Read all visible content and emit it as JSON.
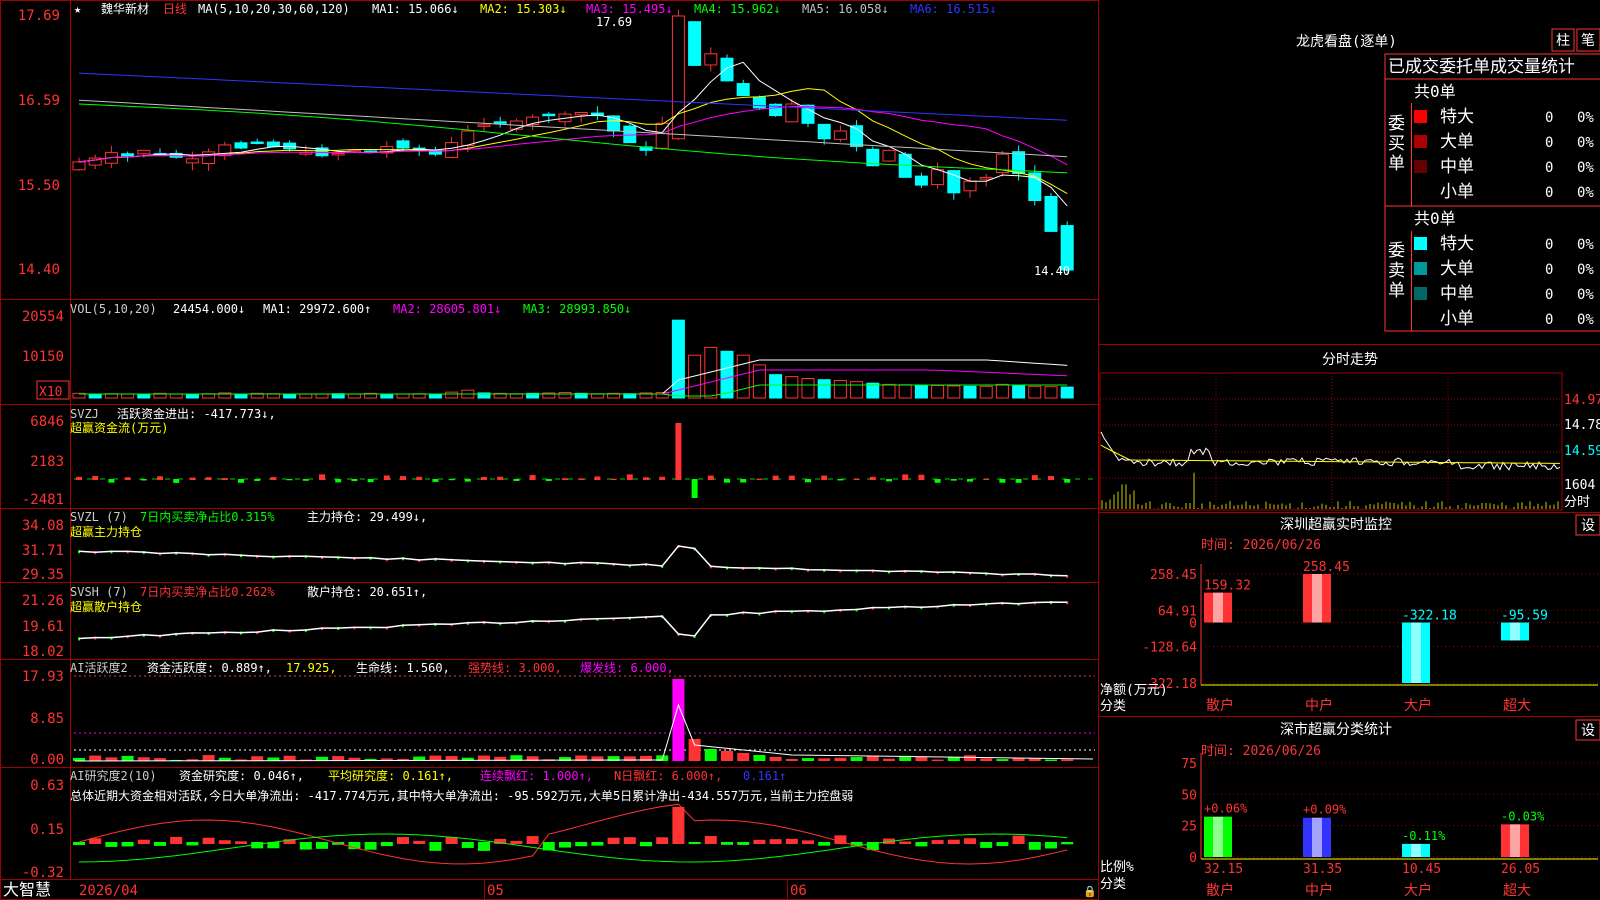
{
  "stock": {
    "name": "魏华新材",
    "period": "日线"
  },
  "panels": {
    "candle": {
      "ma_label": "MA(5,10,20,30,60,120)",
      "ma": [
        {
          "k": "MA1:",
          "v": "15.066↓",
          "color": "#ffffff"
        },
        {
          "k": "MA2:",
          "v": "15.303↓",
          "color": "#ffff00"
        },
        {
          "k": "MA3:",
          "v": "15.495↓",
          "color": "#ff00ff"
        },
        {
          "k": "MA4:",
          "v": "15.962↓",
          "color": "#00ff00"
        },
        {
          "k": "MA5:",
          "v": "16.058↓",
          "color": "#c0c0c0"
        },
        {
          "k": "MA6:",
          "v": "16.515↓",
          "color": "#3333ff"
        }
      ],
      "y_ticks": [
        "17.69",
        "16.59",
        "15.50",
        "14.40"
      ],
      "high_label": "17.69",
      "low_label": "14.40"
    },
    "vol": {
      "label": "VOL(5,10,20)",
      "value": "24454.000↓",
      "ma": [
        {
          "k": "MA1:",
          "v": "29972.600↑",
          "color": "#ffffff"
        },
        {
          "k": "MA2:",
          "v": "28605.801↓",
          "color": "#ff00ff"
        },
        {
          "k": "MA3:",
          "v": "28993.850↓",
          "color": "#00ff00"
        }
      ],
      "y_ticks": [
        "20554",
        "10150"
      ],
      "unit": "X10"
    },
    "svzj": {
      "label": "SVZJ",
      "text": "活跃资金进出: -417.773↓,",
      "sub": "超赢资金流(万元)",
      "y_ticks": [
        "6846",
        "2183",
        "-2481"
      ]
    },
    "svzl": {
      "label": "SVZL (7)",
      "hl": "7日内买卖净占比0.315%",
      "text": "主力持仓: 29.499↓,",
      "sub": "超赢主力持仓",
      "y_ticks": [
        "34.08",
        "31.71",
        "29.35"
      ]
    },
    "svsh": {
      "label": "SVSH (7)",
      "hl": "7日内买卖净占比0.262%",
      "text": "散户持仓: 20.651↑,",
      "sub": "超赢散户持仓",
      "y_ticks": [
        "21.26",
        "19.61",
        "18.02"
      ]
    },
    "ai1": {
      "label": "AI活跃度2",
      "t1": "资金活跃度: 0.889↑,",
      "t2": "17.925,",
      "t3": "生命线: 1.560,",
      "t4": "强势线: 3.000,",
      "t5": "爆发线: 6.000,",
      "y_ticks": [
        "17.93",
        "8.85",
        "0.00"
      ]
    },
    "ai2": {
      "label": "AI研究度2(10)",
      "t1": "资金研究度: 0.046↑,",
      "t2": "平均研究度: 0.161↑,",
      "t3": "连续飘红: 1.000↑,",
      "t4": "N日飘红: 6.000↑,",
      "t5": "0.161↑",
      "note": "总体近期大资金相对活跃,今日大单净流出: -417.774万元,其中特大单净流出: -95.592万元,大单5日累计净出-434.557万元,当前主力控盘弱",
      "y_ticks": [
        "0.63",
        "0.15",
        "-0.32"
      ]
    }
  },
  "dates": [
    "2026/04",
    "05",
    "06"
  ],
  "footer": {
    "brand": "大智慧"
  },
  "lhb": {
    "title": "龙虎看盘(逐单)",
    "btn1": "柱",
    "btn2": "笔",
    "subtitle": "已成交委托单成交量统计",
    "buy": {
      "side": "委买单",
      "total": "共0单",
      "rows": [
        {
          "label": "特大",
          "v": "0",
          "p": "0%",
          "color": "#ff0000"
        },
        {
          "label": "大单",
          "v": "0",
          "p": "0%",
          "color": "#aa0000"
        },
        {
          "label": "中单",
          "v": "0",
          "p": "0%",
          "color": "#660000"
        },
        {
          "label": "小单",
          "v": "0",
          "p": "0%",
          "color": ""
        }
      ]
    },
    "sell": {
      "side": "委卖单",
      "total": "共0单",
      "rows": [
        {
          "label": "特大",
          "v": "0",
          "p": "0%",
          "color": "#00ffff"
        },
        {
          "label": "大单",
          "v": "0",
          "p": "0%",
          "color": "#009999"
        },
        {
          "label": "中单",
          "v": "0",
          "p": "0%",
          "color": "#006666"
        },
        {
          "label": "小单",
          "v": "0",
          "p": "0%",
          "color": ""
        }
      ]
    }
  },
  "intraday": {
    "title": "分时走势",
    "y_ticks": [
      "14.97",
      "14.78",
      "14.59"
    ],
    "vol_label": "1604",
    "unit": "分时"
  },
  "monitor": {
    "title": "深圳超赢实时监控",
    "btn": "设",
    "time": "时间: 2026/06/26",
    "y_ticks": [
      "258.45",
      "64.91",
      "0",
      "-128.64",
      "-322.18"
    ],
    "ylabel": "净额(万元)",
    "xlabel": "分类",
    "chart_data": {
      "type": "bar",
      "categories": [
        "散户",
        "中户",
        "大户",
        "超大"
      ],
      "values": [
        159.32,
        258.45,
        -322.18,
        -95.59
      ],
      "labels": [
        "159.32",
        "258.45",
        "-322.18",
        "-95.59"
      ],
      "ylim": [
        -322.18,
        258.45
      ]
    }
  },
  "classify": {
    "title": "深市超赢分类统计",
    "btn": "设",
    "time": "时间: 2026/06/26",
    "y_ticks": [
      "75",
      "50",
      "25",
      "0"
    ],
    "ylabel": "比例%",
    "xlabel": "分类",
    "chart_data": {
      "type": "bar",
      "categories": [
        "散户",
        "中户",
        "大户",
        "超大"
      ],
      "values": [
        32.15,
        31.35,
        10.45,
        26.05
      ],
      "labels": [
        "32.15",
        "31.35",
        "10.45",
        "26.05"
      ],
      "changes": [
        "+0.06%",
        "+0.09%",
        "-0.11%",
        "-0.03%"
      ],
      "ylim": [
        0,
        75
      ]
    }
  }
}
